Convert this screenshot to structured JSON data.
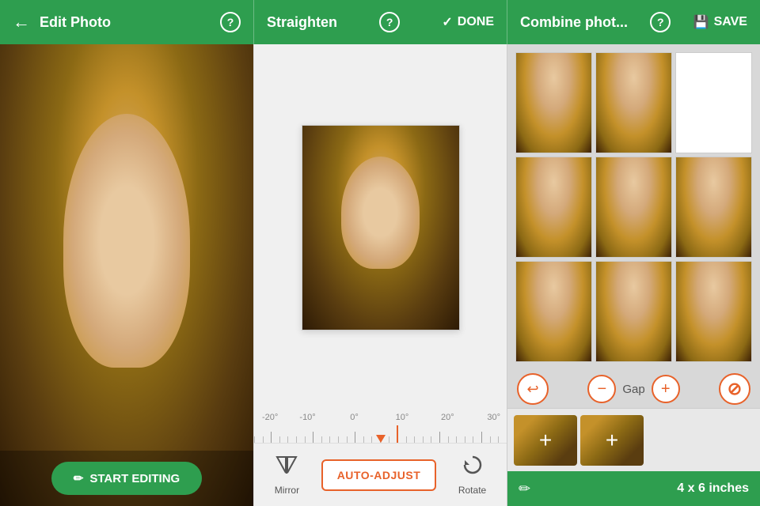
{
  "header": {
    "left": {
      "back_label": "←",
      "title": "Edit Photo",
      "help_label": "?"
    },
    "mid": {
      "title": "Straighten",
      "help_label": "?",
      "done_label": "DONE"
    },
    "right": {
      "title": "Combine phot...",
      "help_label": "?",
      "save_label": "SAVE"
    }
  },
  "left_panel": {
    "start_editing_label": "START EDITING",
    "pencil_icon": "✏"
  },
  "mid_panel": {
    "ruler": {
      "labels": [
        "-20°",
        "-10°",
        "0°",
        "10°",
        "20°",
        "30°"
      ]
    },
    "controls": {
      "mirror_label": "Mirror",
      "auto_adjust_label": "AUTO-ADJUST",
      "rotate_label": "Rotate"
    }
  },
  "right_panel": {
    "gap_label": "Gap",
    "size_text": "4 x 6 inches",
    "undo_icon": "↩",
    "no_border_icon": "⊘",
    "add_plus": "+",
    "edit_icon": "✏"
  }
}
